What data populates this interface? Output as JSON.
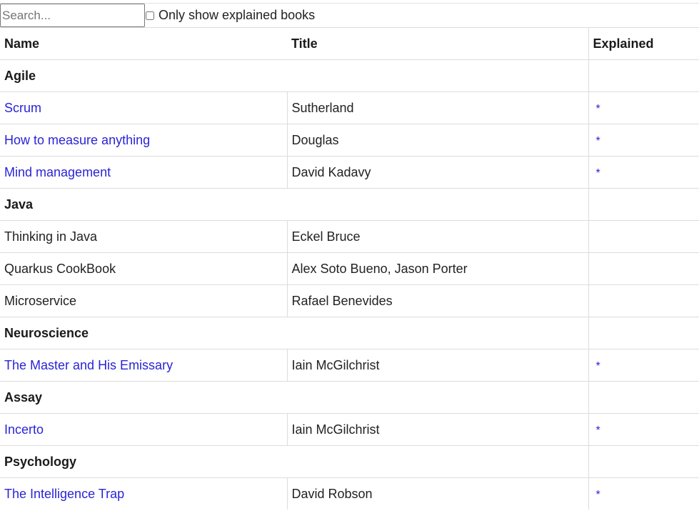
{
  "search": {
    "placeholder": "Search...",
    "value": ""
  },
  "filter": {
    "label": "Only show explained books",
    "checked": false
  },
  "table": {
    "headers": {
      "name": "Name",
      "title": "Title",
      "explained": "Explained"
    },
    "groups": [
      {
        "name": "Agile",
        "rows": [
          {
            "name": "Scrum",
            "title": "Sutherland",
            "explained": "*",
            "link": true
          },
          {
            "name": "How to measure anything",
            "title": "Douglas",
            "explained": "*",
            "link": true
          },
          {
            "name": "Mind management",
            "title": "David Kadavy",
            "explained": "*",
            "link": true
          }
        ]
      },
      {
        "name": "Java",
        "rows": [
          {
            "name": "Thinking in Java",
            "title": "Eckel Bruce",
            "explained": "",
            "link": false
          },
          {
            "name": "Quarkus CookBook",
            "title": "Alex Soto Bueno, Jason Porter",
            "explained": "",
            "link": false
          },
          {
            "name": "Microservice",
            "title": "Rafael Benevides",
            "explained": "",
            "link": false
          }
        ]
      },
      {
        "name": "Neuroscience",
        "rows": [
          {
            "name": "The Master and His Emissary",
            "title": "Iain McGilchrist",
            "explained": "*",
            "link": true
          }
        ]
      },
      {
        "name": "Assay",
        "rows": [
          {
            "name": "Incerto",
            "title": "Iain McGilchrist",
            "explained": "*",
            "link": true
          }
        ]
      },
      {
        "name": "Psychology",
        "rows": [
          {
            "name": "The Intelligence Trap",
            "title": "David Robson",
            "explained": "*",
            "link": true
          }
        ]
      }
    ]
  },
  "colors": {
    "link": "#2a24d6",
    "border": "#dcdcdc",
    "text": "#222222"
  }
}
